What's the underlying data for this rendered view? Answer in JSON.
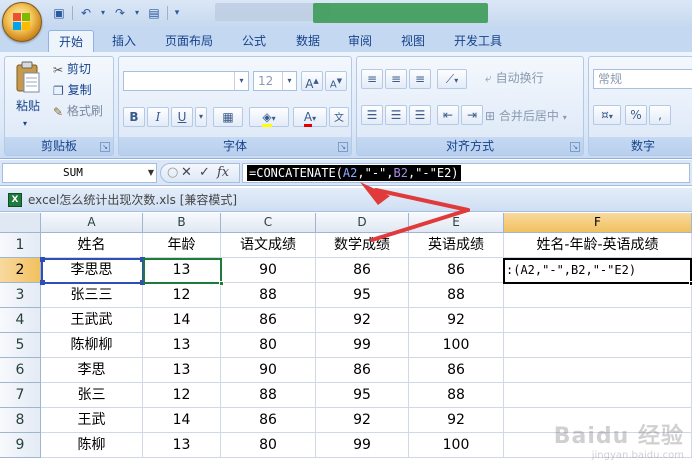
{
  "ribbon": {
    "tabs": [
      "开始",
      "插入",
      "页面布局",
      "公式",
      "数据",
      "审阅",
      "视图",
      "开发工具"
    ],
    "active_tab": "开始",
    "clipboard": {
      "paste": "粘贴",
      "cut": "剪切",
      "copy": "复制",
      "format_painter": "格式刷",
      "group_label": "剪贴板"
    },
    "font": {
      "name_value": "",
      "size_value": "12",
      "bold": "B",
      "italic": "I",
      "underline": "U",
      "group_label": "字体"
    },
    "alignment": {
      "wrap_text": "自动换行",
      "merge_center": "合并后居中",
      "group_label": "对齐方式"
    },
    "number": {
      "format_value": "常规",
      "percent": "%",
      "comma": ",",
      "group_label": "数字"
    }
  },
  "formula_bar": {
    "name_box": "SUM",
    "cancel": "✕",
    "enter": "✓",
    "fx": "fx",
    "formula": {
      "p1": "=CONCATENATE(",
      "p2": "A2",
      "p3": ",\"-\",",
      "p4": "B2",
      "p5": ",\"-\"E2)"
    }
  },
  "workbook": {
    "title": "excel怎么统计出现次数.xls  [兼容模式]"
  },
  "sheet": {
    "columns": [
      "A",
      "B",
      "C",
      "D",
      "E",
      "F"
    ],
    "rows": [
      [
        "姓名",
        "年龄",
        "语文成绩",
        "数学成绩",
        "英语成绩",
        "姓名-年龄-英语成绩"
      ],
      [
        "李思思",
        "13",
        "90",
        "86",
        "86",
        ":(A2,\"-\",B2,\"-\"E2)"
      ],
      [
        "张三三",
        "12",
        "88",
        "95",
        "88",
        ""
      ],
      [
        "王武武",
        "14",
        "86",
        "92",
        "92",
        ""
      ],
      [
        "陈柳柳",
        "13",
        "80",
        "99",
        "100",
        ""
      ],
      [
        "李思",
        "13",
        "90",
        "86",
        "86",
        ""
      ],
      [
        "张三",
        "12",
        "88",
        "95",
        "88",
        ""
      ],
      [
        "王武",
        "14",
        "86",
        "92",
        "92",
        ""
      ],
      [
        "陈柳",
        "13",
        "80",
        "99",
        "100",
        ""
      ]
    ],
    "row_numbers": [
      "1",
      "2",
      "3",
      "4",
      "5",
      "6",
      "7",
      "8",
      "9"
    ]
  },
  "colors": {
    "ref_a2": "#2e4fb7",
    "ref_b2": "#1e7b3a",
    "formula_default": "#ffffff",
    "formula_a2": "#8ea9ff",
    "formula_b2": "#a98ee0",
    "arrow": "#e03a3a"
  }
}
